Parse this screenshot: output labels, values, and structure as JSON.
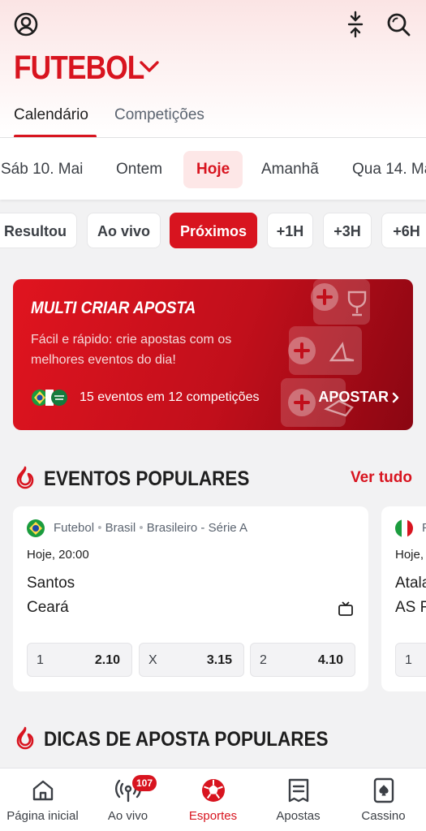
{
  "header": {
    "title": "FUTEBOL",
    "profile_icon": "user-circle-icon",
    "collapse_icon": "collapse-arrows-icon",
    "search_icon": "search-icon"
  },
  "tabs": [
    {
      "label": "Calendário",
      "active": true
    },
    {
      "label": "Competições",
      "active": false
    }
  ],
  "dates": [
    {
      "label": "Sáb 10. Mai"
    },
    {
      "label": "Ontem"
    },
    {
      "label": "Hoje",
      "active": true
    },
    {
      "label": "Amanhã"
    },
    {
      "label": "Qua 14. Mai"
    }
  ],
  "filters": [
    {
      "label": "Resultou"
    },
    {
      "label": "Ao vivo"
    },
    {
      "label": "Próximos",
      "active": true
    },
    {
      "label": "+1H"
    },
    {
      "label": "+3H"
    },
    {
      "label": "+6H"
    }
  ],
  "promo": {
    "title": "MULTI CRIAR APOSTA",
    "description": "Fácil e rápido: crie apostas com os melhores eventos do dia!",
    "count_text": "15 eventos em 12 competições",
    "cta": "APOSTAR"
  },
  "popular_events": {
    "title": "EVENTOS POPULARES",
    "see_all": "Ver tudo",
    "cards": [
      {
        "sport": "Futebol",
        "country": "Brasil",
        "league": "Brasileiro - Série A",
        "time": "Hoje, 20:00",
        "home": "Santos",
        "away": "Ceará",
        "odds": [
          {
            "label": "1",
            "value": "2.10"
          },
          {
            "label": "X",
            "value": "3.15"
          },
          {
            "label": "2",
            "value": "4.10"
          }
        ]
      },
      {
        "sport": "F",
        "time": "Hoje,",
        "home": "Atala",
        "away": "AS R",
        "odds": [
          {
            "label": "1",
            "value": ""
          }
        ]
      }
    ]
  },
  "popular_tips": {
    "title": "DICAS DE APOSTA POPULARES"
  },
  "bottom_nav": [
    {
      "label": "Página inicial",
      "icon": "home-icon"
    },
    {
      "label": "Ao vivo",
      "icon": "live-icon",
      "badge": "107"
    },
    {
      "label": "Esportes",
      "icon": "soccer-ball-icon",
      "active": true
    },
    {
      "label": "Apostas",
      "icon": "betslip-icon"
    },
    {
      "label": "Cassino",
      "icon": "card-icon"
    }
  ],
  "colors": {
    "accent": "#d8141f",
    "background": "#f2f2f3"
  }
}
